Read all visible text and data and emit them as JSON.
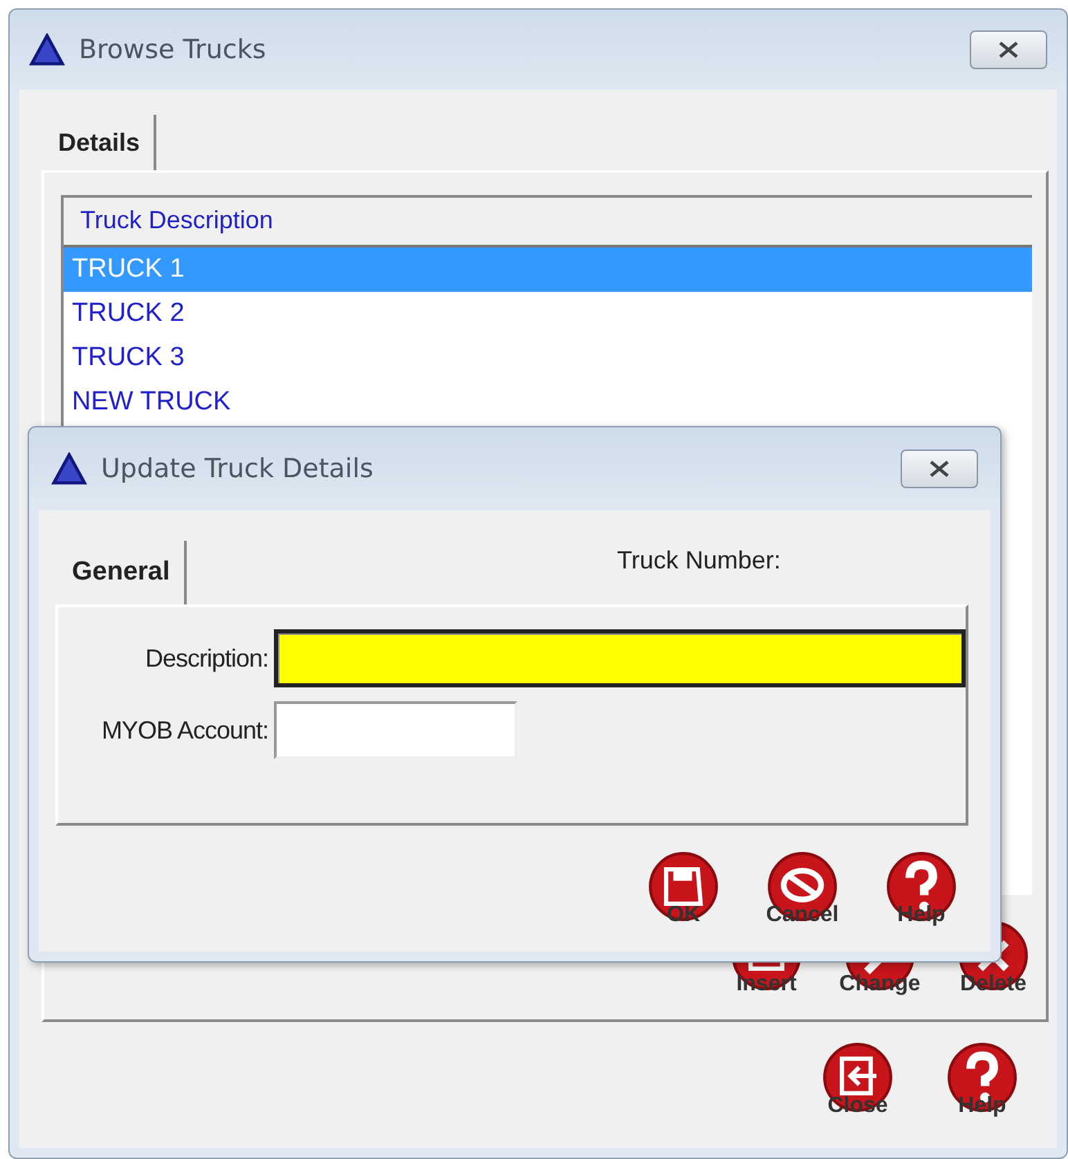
{
  "browse_window": {
    "title": "Browse Trucks",
    "tabs": [
      {
        "label": "Details",
        "selected": true
      }
    ],
    "table": {
      "columns": [
        "Truck Description"
      ],
      "rows": [
        {
          "cells": [
            "TRUCK 1"
          ],
          "selected": true
        },
        {
          "cells": [
            "TRUCK 2"
          ],
          "selected": false
        },
        {
          "cells": [
            "TRUCK 3"
          ],
          "selected": false
        },
        {
          "cells": [
            "NEW TRUCK"
          ],
          "selected": false
        }
      ]
    },
    "panel_buttons": [
      {
        "label": "Insert",
        "kind": "insert"
      },
      {
        "label": "Change",
        "kind": "change"
      },
      {
        "label": "Delete",
        "kind": "delete"
      }
    ],
    "footer_buttons": [
      {
        "label": "Close",
        "kind": "close"
      },
      {
        "label": "Help",
        "kind": "help"
      }
    ]
  },
  "update_dialog": {
    "title": "Update Truck Details",
    "tabs": [
      {
        "label": "General",
        "selected": true
      }
    ],
    "truck_number_label": "Truck Number:",
    "fields": [
      {
        "label": "Description:",
        "focused": true
      },
      {
        "label": "MYOB Account:",
        "focused": false
      }
    ],
    "buttons": [
      {
        "label": "OK",
        "kind": "save"
      },
      {
        "label": "Cancel",
        "kind": "cancel"
      },
      {
        "label": "Help",
        "kind": "help"
      }
    ]
  }
}
